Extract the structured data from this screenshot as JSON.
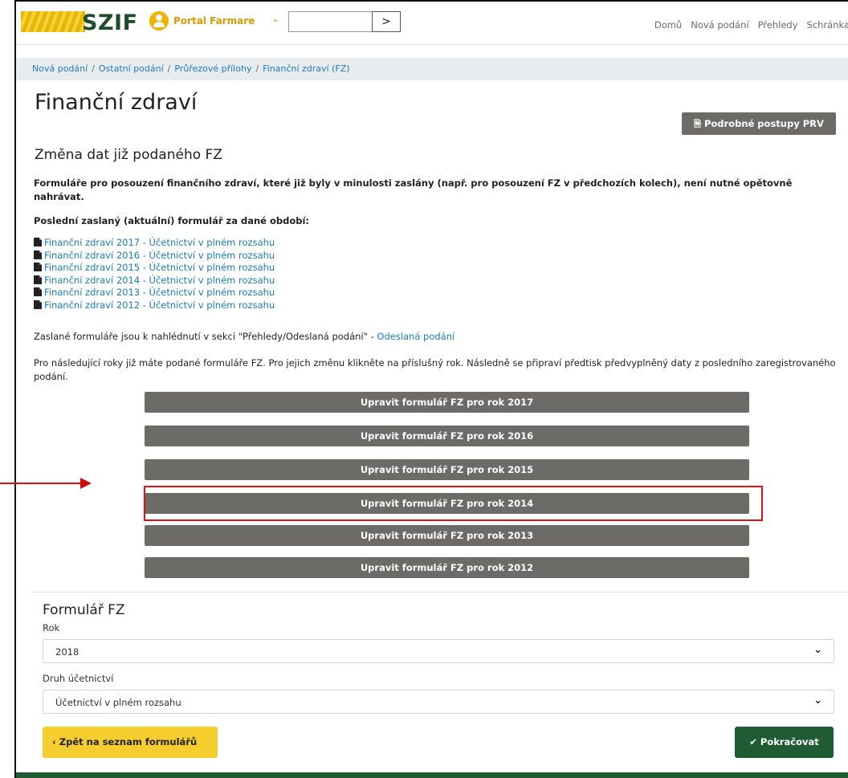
{
  "header": {
    "logo_text": "SZIF",
    "portal_label": "Portal Farmare",
    "search_placeholder": "",
    "search_go": ">",
    "nav": [
      "Domů",
      "Nová podání",
      "Přehledy",
      "Schránka"
    ]
  },
  "breadcrumb": [
    "Nová podání",
    "Ostatní podání",
    "Průřezové přílohy",
    "Finanční zdraví (FZ)"
  ],
  "page": {
    "title": "Finanční zdraví",
    "postupy_button": "Podrobné postupy PRV",
    "section_title": "Změna dat již podaného FZ",
    "bold_note": "Formuláře pro posouzení finančního zdraví, které již byly v minulosti zaslány (např. pro posouzení FZ v předchozích kolech), není nutné opětovně nahrávat.",
    "bold_note2": "Poslední zaslaný (aktuální) formulář za dané období:",
    "pdf_links": [
      "Finanční zdraví 2017 - Účetnictví v plném rozsahu",
      "Finanční zdraví 2016 - Účetnictví v plném rozsahu",
      "Finanční zdraví 2015 - Účetnictví v plném rozsahu",
      "Finanční zdraví 2014 - Účetnictví v plném rozsahu",
      "Finanční zdraví 2013 - Účetnictví v plném rozsahu",
      "Finanční zdraví 2012 - Účetnictví v plném rozsahu"
    ],
    "sent_text": "Zaslané formuláře jsou k nahlédnutí v sekci \"Přehledy/Odeslaná podání\" - ",
    "sent_link": "Odeslaná podání",
    "info_para": "Pro následující roky již máte podané formuláře FZ. Pro jejich změnu klikněte na příslušný rok. Následně se připraví předtisk předvyplněný daty z posledního zaregistrovaného podání.",
    "year_buttons": [
      "Upravit formulář FZ pro rok 2017",
      "Upravit formulář FZ pro rok 2016",
      "Upravit formulář FZ pro rok 2015",
      "Upravit formulář FZ pro rok 2014",
      "Upravit formulář FZ pro rok 2013",
      "Upravit formulář FZ pro rok 2012"
    ],
    "highlighted_year_index": 3
  },
  "form": {
    "title": "Formulář FZ",
    "rok_label": "Rok",
    "rok_value": "2018",
    "druh_label": "Druh účetnictví",
    "druh_value": "Účetnictví v plném rozsahu",
    "back_button": "Zpět na seznam formulářů",
    "next_button": "Pokračovat"
  },
  "colors": {
    "brand_green": "#1f5c33",
    "brand_yellow": "#f5cd2e",
    "button_grey": "#6c6b67",
    "link_blue": "#1a7bbf",
    "highlight_red": "#e01212"
  }
}
